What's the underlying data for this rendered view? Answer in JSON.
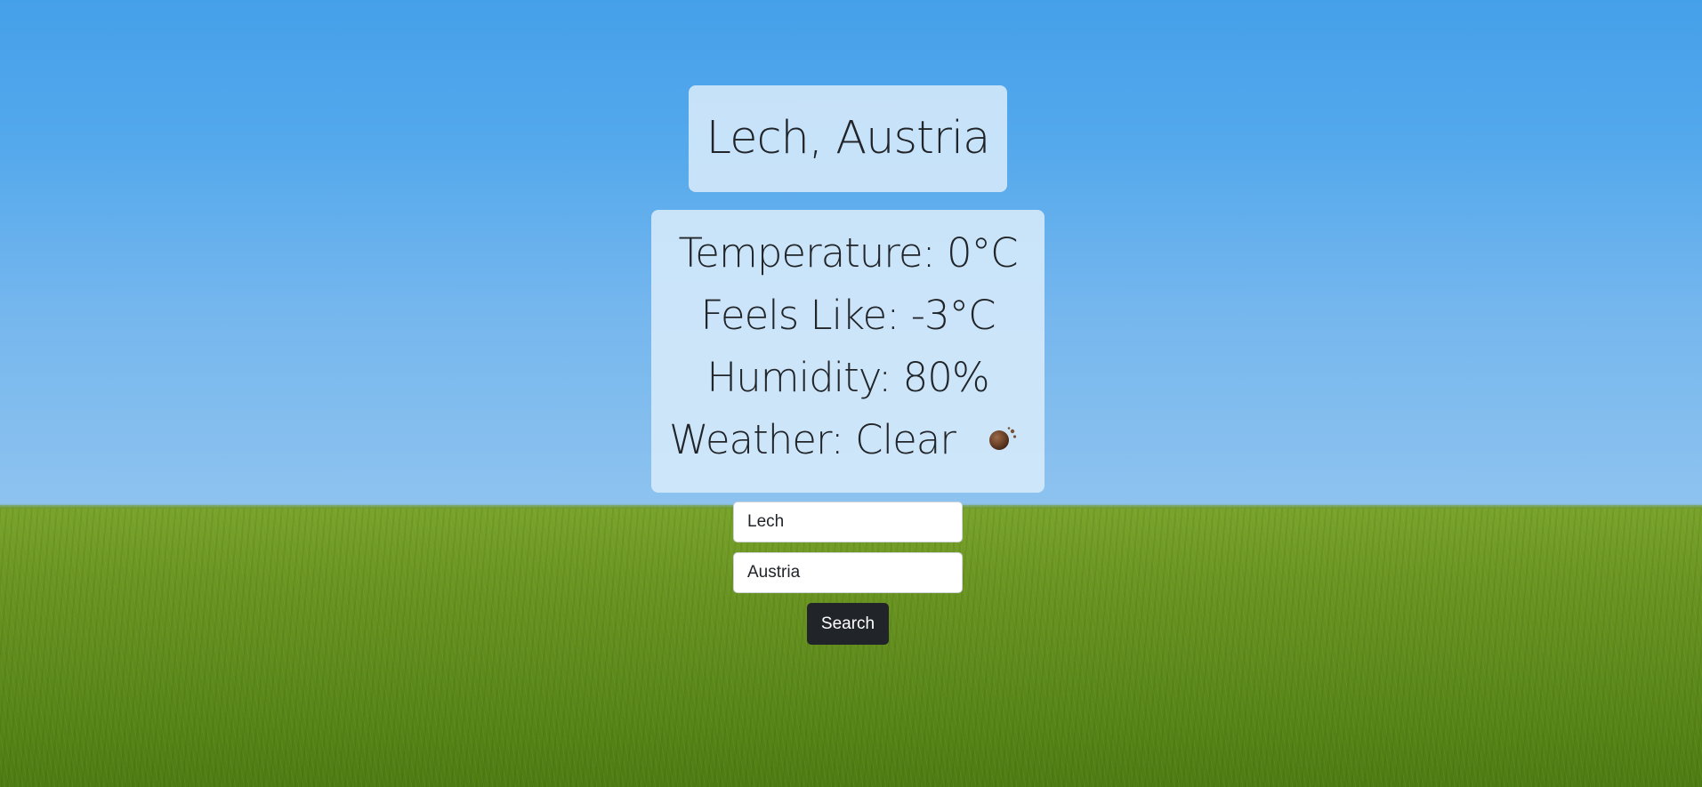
{
  "location": {
    "title": "Lech, Austria"
  },
  "weather": {
    "temperature": "Temperature: 0°C",
    "feels_like": "Feels Like: -3°C",
    "humidity": "Humidity: 80%",
    "condition": "Weather: Clear",
    "icon": "clear-weather-icon"
  },
  "search_form": {
    "city_value": "Lech",
    "country_value": "Austria",
    "button_label": "Search"
  }
}
